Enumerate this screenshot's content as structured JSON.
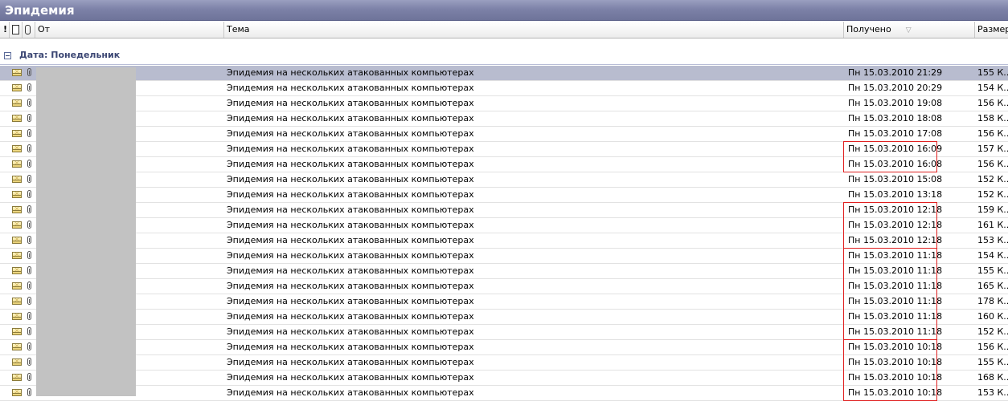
{
  "window": {
    "title": "Эпидемия"
  },
  "columns": {
    "importance": "!",
    "type": "",
    "attachment": "",
    "from": "От",
    "subject": "Тема",
    "received": "Получено",
    "size": "Размер"
  },
  "group": {
    "label": "Дата: Понедельник"
  },
  "messages": [
    {
      "subject": "Эпидемия на нескольких атакованных компьютерах",
      "received": "Пн 15.03.2010 21:29",
      "size": "155 К...",
      "selected": true
    },
    {
      "subject": "Эпидемия на нескольких атакованных компьютерах",
      "received": "Пн 15.03.2010 20:29",
      "size": "154 К..."
    },
    {
      "subject": "Эпидемия на нескольких атакованных компьютерах",
      "received": "Пн 15.03.2010 19:08",
      "size": "156 К..."
    },
    {
      "subject": "Эпидемия на нескольких атакованных компьютерах",
      "received": "Пн 15.03.2010 18:08",
      "size": "158 К..."
    },
    {
      "subject": "Эпидемия на нескольких атакованных компьютерах",
      "received": "Пн 15.03.2010 17:08",
      "size": "156 К..."
    },
    {
      "subject": "Эпидемия на нескольких атакованных компьютерах",
      "received": "Пн 15.03.2010 16:09",
      "size": "157 К..."
    },
    {
      "subject": "Эпидемия на нескольких атакованных компьютерах",
      "received": "Пн 15.03.2010 16:08",
      "size": "156 К..."
    },
    {
      "subject": "Эпидемия на нескольких атакованных компьютерах",
      "received": "Пн 15.03.2010 15:08",
      "size": "152 К..."
    },
    {
      "subject": "Эпидемия на нескольких атакованных компьютерах",
      "received": "Пн 15.03.2010 13:18",
      "size": "152 К..."
    },
    {
      "subject": "Эпидемия на нескольких атакованных компьютерах",
      "received": "Пн 15.03.2010 12:18",
      "size": "159 К..."
    },
    {
      "subject": "Эпидемия на нескольких атакованных компьютерах",
      "received": "Пн 15.03.2010 12:18",
      "size": "161 К..."
    },
    {
      "subject": "Эпидемия на нескольких атакованных компьютерах",
      "received": "Пн 15.03.2010 12:18",
      "size": "153 К..."
    },
    {
      "subject": "Эпидемия на нескольких атакованных компьютерах",
      "received": "Пн 15.03.2010 11:18",
      "size": "154 К..."
    },
    {
      "subject": "Эпидемия на нескольких атакованных компьютерах",
      "received": "Пн 15.03.2010 11:18",
      "size": "155 К..."
    },
    {
      "subject": "Эпидемия на нескольких атакованных компьютерах",
      "received": "Пн 15.03.2010 11:18",
      "size": "165 К..."
    },
    {
      "subject": "Эпидемия на нескольких атакованных компьютерах",
      "received": "Пн 15.03.2010 11:18",
      "size": "178 К..."
    },
    {
      "subject": "Эпидемия на нескольких атакованных компьютерах",
      "received": "Пн 15.03.2010 11:18",
      "size": "160 К..."
    },
    {
      "subject": "Эпидемия на нескольких атакованных компьютерах",
      "received": "Пн 15.03.2010 11:18",
      "size": "152 К..."
    },
    {
      "subject": "Эпидемия на нескольких атакованных компьютерах",
      "received": "Пн 15.03.2010 10:18",
      "size": "156 К..."
    },
    {
      "subject": "Эпидемия на нескольких атакованных компьютерах",
      "received": "Пн 15.03.2010 10:18",
      "size": "155 К..."
    },
    {
      "subject": "Эпидемия на нескольких атакованных компьютерах",
      "received": "Пн 15.03.2010 10:18",
      "size": "168 К..."
    },
    {
      "subject": "Эпидемия на нескольких атакованных компьютерах",
      "received": "Пн 15.03.2010 10:18",
      "size": "153 К..."
    }
  ],
  "highlight_groups": [
    {
      "first": 5,
      "last": 6
    },
    {
      "first": 9,
      "last": 11
    },
    {
      "first": 12,
      "last": 17
    },
    {
      "first": 18,
      "last": 21
    }
  ],
  "colors": {
    "titlebar": "#7d82a8",
    "selected_row": "#b8bccf",
    "highlight_box": "#e02020",
    "redaction": "#c2c2c2"
  },
  "icons": {
    "unread": "envelope-icon",
    "attachment": "paperclip-icon"
  }
}
